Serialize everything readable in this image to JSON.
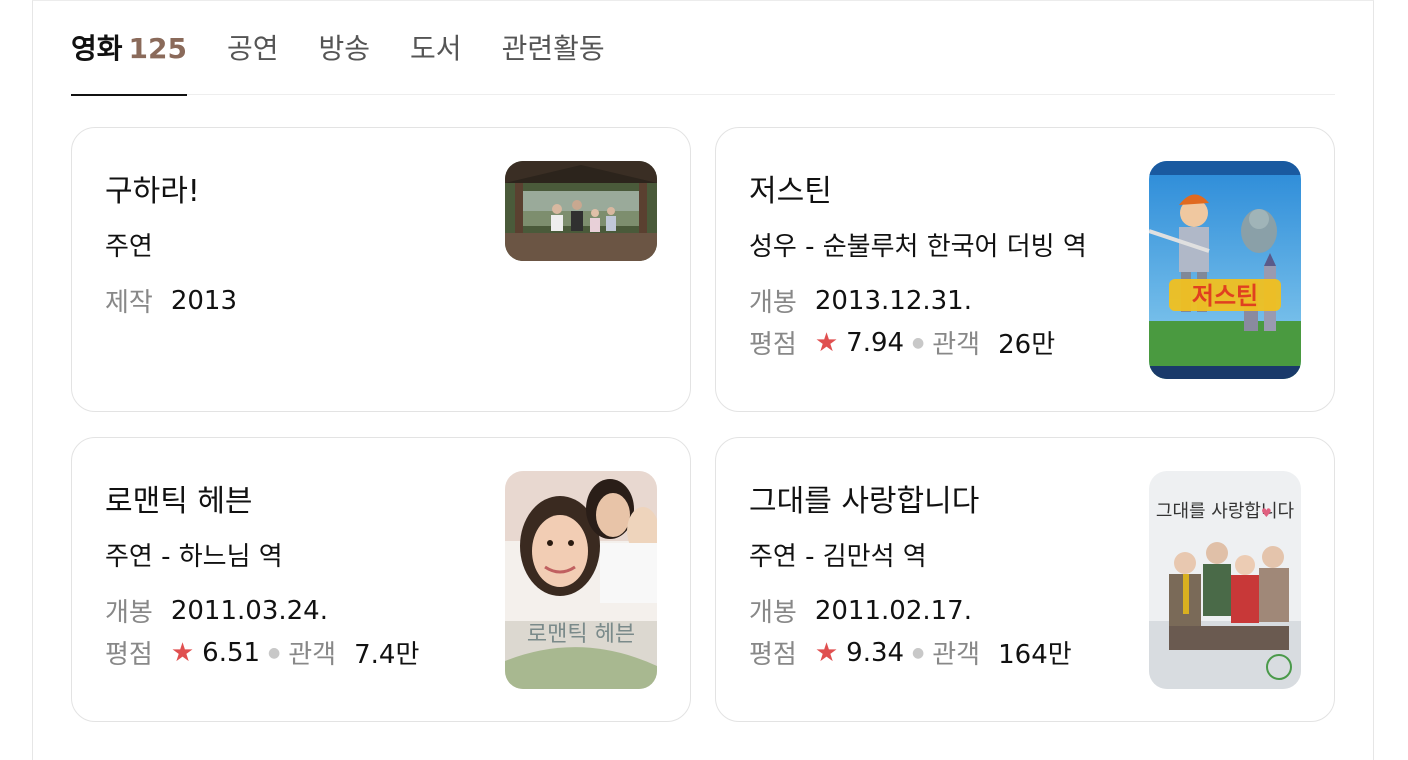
{
  "tabs": [
    {
      "label": "영화",
      "count": "125",
      "active": true
    },
    {
      "label": "공연"
    },
    {
      "label": "방송"
    },
    {
      "label": "도서"
    },
    {
      "label": "관련활동"
    }
  ],
  "cards": [
    {
      "title": "구하라!",
      "role": "주연",
      "line1_label": "제작",
      "line1_value": "2013"
    },
    {
      "title": "저스틴",
      "role": "성우 - 순불루처 한국어 더빙 역",
      "line1_label": "개봉",
      "line1_value": "2013.12.31.",
      "rating_label": "평점",
      "rating_star": "★",
      "rating_value": "7.94",
      "audience_label": "관객",
      "audience_value": "26만",
      "poster_text": "저스틴"
    },
    {
      "title": "로맨틱 헤븐",
      "role": "주연 - 하느님 역",
      "line1_label": "개봉",
      "line1_value": "2011.03.24.",
      "rating_label": "평점",
      "rating_star": "★",
      "rating_value": "6.51",
      "audience_label": "관객",
      "audience_value": "7.4만",
      "poster_text": "로맨틱 헤븐"
    },
    {
      "title": "그대를 사랑합니다",
      "role": "주연 - 김만석 역",
      "line1_label": "개봉",
      "line1_value": "2011.02.17.",
      "rating_label": "평점",
      "rating_star": "★",
      "rating_value": "9.34",
      "audience_label": "관객",
      "audience_value": "164만",
      "poster_text": "그대를 사랑합니다"
    }
  ],
  "colors": {
    "tab_count": "#8a6a5a",
    "star": "#e05050",
    "label": "#888888",
    "border": "#e3e3e3"
  }
}
